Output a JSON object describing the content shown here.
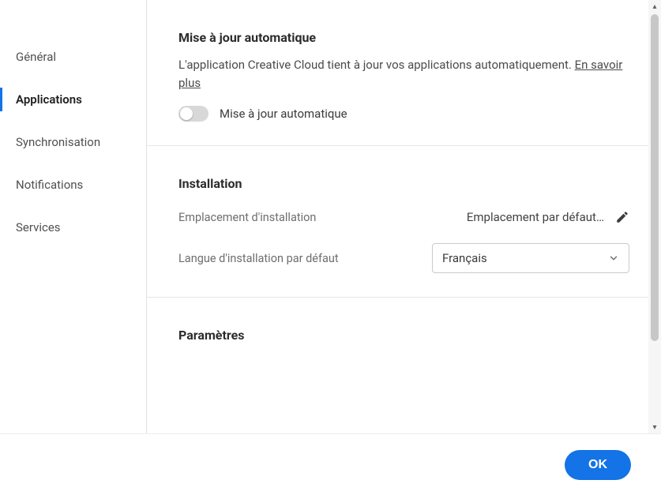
{
  "sidebar": {
    "items": [
      {
        "label": "Général"
      },
      {
        "label": "Applications"
      },
      {
        "label": "Synchronisation"
      },
      {
        "label": "Notifications"
      },
      {
        "label": "Services"
      }
    ],
    "activeIndex": 1
  },
  "autoupdate": {
    "title": "Mise à jour automatique",
    "desc_prefix": "L'application Creative Cloud tient à jour vos applications automatiquement. ",
    "learn_more": "En savoir plus",
    "toggle_label": "Mise à jour automatique",
    "toggle_on": false
  },
  "installation": {
    "title": "Installation",
    "location_label": "Emplacement d'installation",
    "location_value": "Emplacement par défaut…",
    "language_label": "Langue d'installation par défaut",
    "language_value": "Français"
  },
  "settings": {
    "title": "Paramètres"
  },
  "footer": {
    "ok_label": "OK"
  }
}
